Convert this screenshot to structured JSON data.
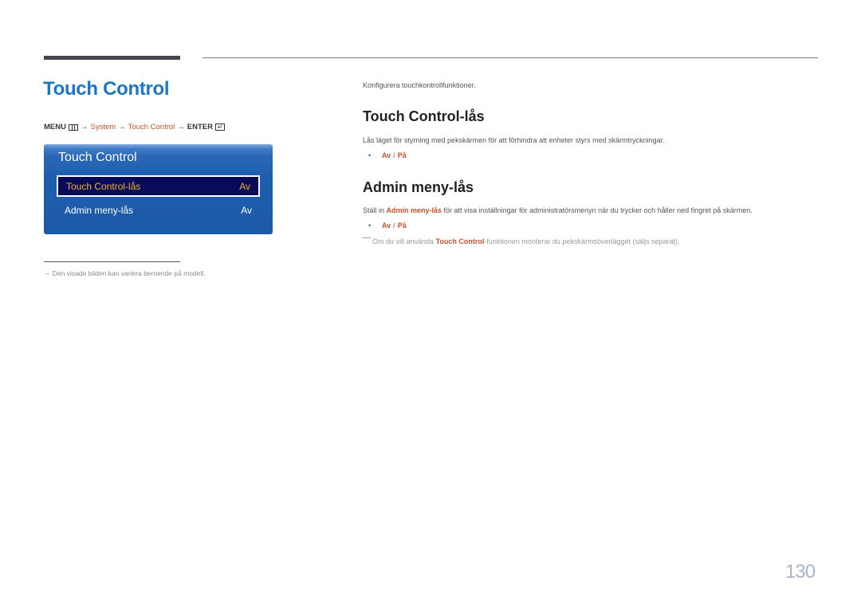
{
  "page": {
    "title": "Touch Control",
    "number": "130"
  },
  "breadcrumb": {
    "menu": "MENU",
    "menu_icon": "menu-grid-icon",
    "arrow": "→",
    "system": "System",
    "touch_control": "Touch Control",
    "enter": "ENTER",
    "enter_icon": "enter-icon"
  },
  "osd": {
    "title": "Touch Control",
    "items": [
      {
        "label": "Touch Control-lås",
        "value": "Av",
        "selected": true
      },
      {
        "label": "Admin meny-lås",
        "value": "Av",
        "selected": false
      }
    ]
  },
  "footnote": {
    "mark": "–",
    "text": "Den visade bilden kan variera beroende på modell."
  },
  "content": {
    "intro": "Konfigurera touchkontrollfunktioner.",
    "sections": [
      {
        "heading": "Touch Control-lås",
        "text": "Lås läget för styrning med pekskärmen för att förhindra att enheter styrs med skärmtryckningar.",
        "options": [
          "Av",
          "På"
        ],
        "option_separator": "/"
      },
      {
        "heading": "Admin meny-lås",
        "text_pre": "Ställ in ",
        "text_highlight": "Admin meny-lås",
        "text_post": " för att visa inställningar för administratörsmenyn när du trycker och håller ned fingret på skärmen.",
        "options": [
          "Av",
          "På"
        ],
        "option_separator": "/"
      }
    ],
    "note": {
      "pre": "Om du vill använda ",
      "highlight": "Touch Control",
      "post": "-funktionen monterar du pekskärmsöverlägget (säljs separat)."
    }
  },
  "colors": {
    "title_blue": "#1d76c2",
    "highlight_orange": "#c8502a",
    "osd_blue": "#1f5eae",
    "osd_selected_bg": "#0a0a5a",
    "osd_selected_text": "#f0b32b"
  }
}
